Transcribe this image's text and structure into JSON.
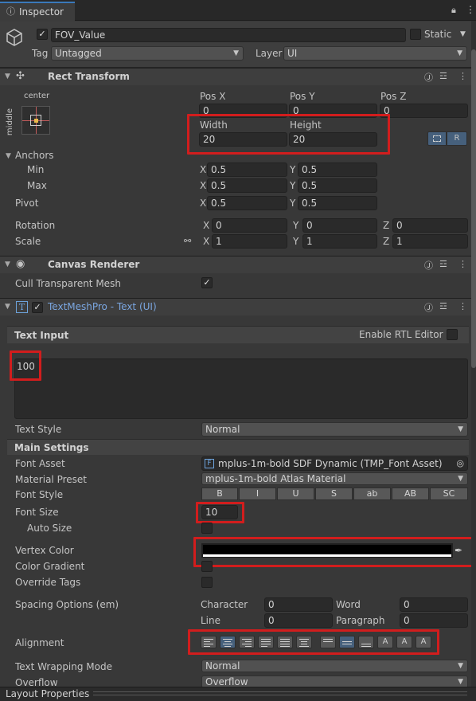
{
  "tab": {
    "title": "Inspector"
  },
  "object": {
    "name": "FOV_Value",
    "static_label": "Static",
    "tag_label": "Tag",
    "tag_value": "Untagged",
    "layer_label": "Layer",
    "layer_value": "UI"
  },
  "rect_transform": {
    "title": "Rect Transform",
    "anchor_h": "center",
    "anchor_v": "middle",
    "pos_x_label": "Pos X",
    "pos_y_label": "Pos Y",
    "pos_z_label": "Pos Z",
    "pos_x": "0",
    "pos_y": "0",
    "pos_z": "0",
    "width_label": "Width",
    "height_label": "Height",
    "width": "20",
    "height": "20",
    "r_label": "R",
    "anchors_label": "Anchors",
    "min_label": "Min",
    "max_label": "Max",
    "x": "X",
    "y": "Y",
    "z": "Z",
    "min_x": "0.5",
    "min_y": "0.5",
    "max_x": "0.5",
    "max_y": "0.5",
    "pivot_label": "Pivot",
    "pivot_x": "0.5",
    "pivot_y": "0.5",
    "rotation_label": "Rotation",
    "rot_x": "0",
    "rot_y": "0",
    "rot_z": "0",
    "scale_label": "Scale",
    "scale_x": "1",
    "scale_y": "1",
    "scale_z": "1"
  },
  "canvas_renderer": {
    "title": "Canvas Renderer",
    "cull_label": "Cull Transparent Mesh"
  },
  "tmp": {
    "title": "TextMeshPro - Text (UI)",
    "text_input_label": "Text Input",
    "rtl_label": "Enable RTL Editor",
    "text_value": "100",
    "text_style_label": "Text Style",
    "text_style_value": "Normal",
    "main_settings_label": "Main Settings",
    "font_asset_label": "Font Asset",
    "font_asset_value": "mplus-1m-bold SDF Dynamic (TMP_Font Asset)",
    "material_preset_label": "Material Preset",
    "material_preset_value": "mplus-1m-bold Atlas Material",
    "font_style_label": "Font Style",
    "font_style_buttons": [
      "B",
      "I",
      "U",
      "S",
      "ab",
      "AB",
      "SC"
    ],
    "font_size_label": "Font Size",
    "font_size_value": "10",
    "auto_size_label": "Auto Size",
    "vertex_color_label": "Vertex Color",
    "vertex_color": "#000000",
    "color_gradient_label": "Color Gradient",
    "override_tags_label": "Override Tags",
    "spacing_label": "Spacing Options (em)",
    "character_label": "Character",
    "character_value": "0",
    "word_label": "Word",
    "word_value": "0",
    "line_label": "Line",
    "line_value": "0",
    "paragraph_label": "Paragraph",
    "paragraph_value": "0",
    "alignment_label": "Alignment",
    "wrapping_label": "Text Wrapping Mode",
    "wrapping_value": "Normal",
    "overflow_label": "Overflow",
    "overflow_value": "Overflow"
  },
  "footer": {
    "title": "Layout Properties"
  },
  "colors": {
    "highlight": "#d21d1d",
    "link_blue": "#7aa6e0",
    "background": "#383838"
  }
}
